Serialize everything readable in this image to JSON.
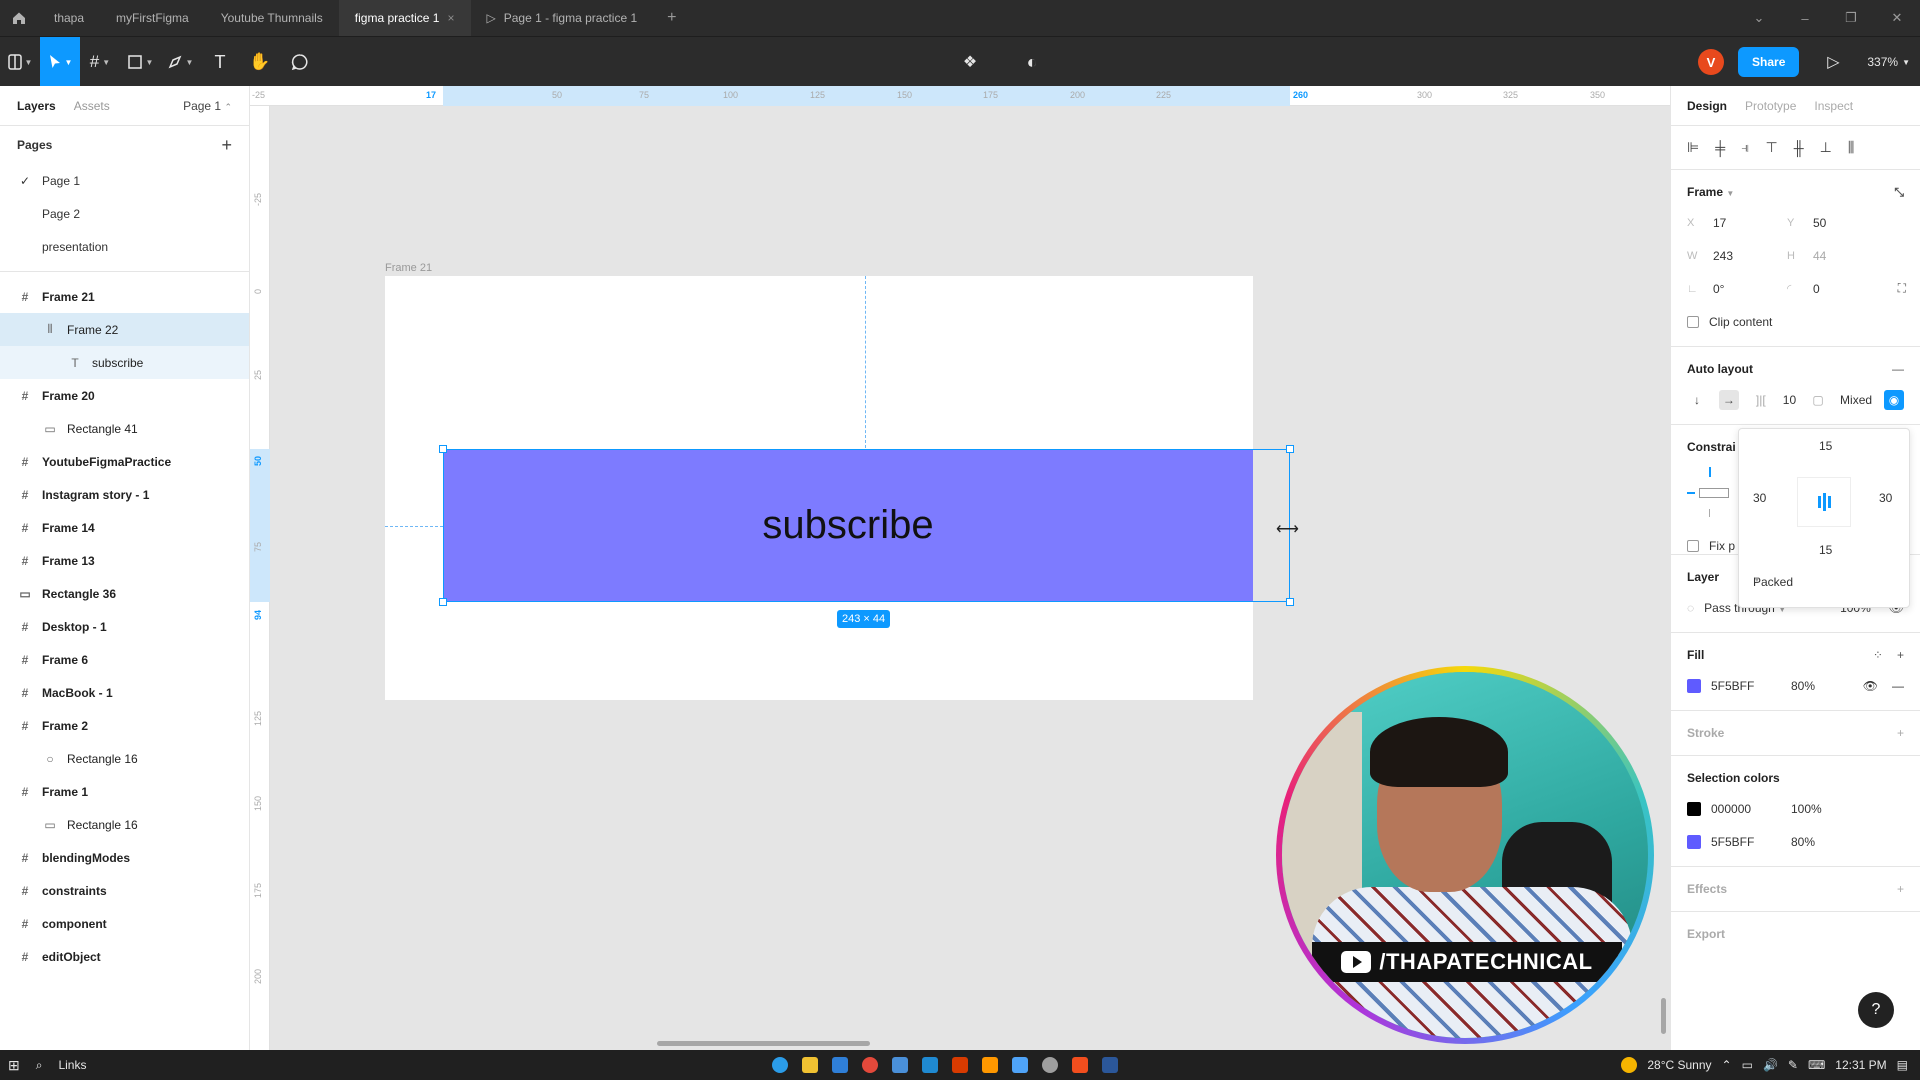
{
  "tabs": [
    {
      "label": "thapa"
    },
    {
      "label": "myFirstFigma"
    },
    {
      "label": "Youtube Thumnails"
    },
    {
      "label": "figma practice 1",
      "active": true
    },
    {
      "label": "Page 1 - figma practice 1"
    }
  ],
  "toolbar": {
    "share_label": "Share",
    "avatar_initial": "V",
    "zoom": "337%"
  },
  "left_panel": {
    "tab_layers": "Layers",
    "tab_assets": "Assets",
    "page_selector": "Page 1",
    "pages_title": "Pages",
    "pages": [
      "Page 1",
      "Page 2",
      "presentation"
    ],
    "layers": [
      {
        "label": "Frame 21",
        "level": 0,
        "icon": "frame-icon"
      },
      {
        "label": "Frame 22",
        "level": 1,
        "icon": "auto-layout-icon"
      },
      {
        "label": "subscribe",
        "level": 2,
        "icon": "text-icon"
      },
      {
        "label": "Frame 20",
        "level": 0,
        "icon": "frame-icon"
      },
      {
        "label": "Rectangle 41",
        "level": 1,
        "icon": "rectangle-icon"
      },
      {
        "label": "YoutubeFigmaPractice",
        "level": 0,
        "icon": "frame-icon"
      },
      {
        "label": "Instagram story - 1",
        "level": 0,
        "icon": "frame-icon"
      },
      {
        "label": "Frame 14",
        "level": 0,
        "icon": "frame-icon"
      },
      {
        "label": "Frame 13",
        "level": 0,
        "icon": "frame-icon"
      },
      {
        "label": "Rectangle 36",
        "level": 0,
        "icon": "rectangle-icon"
      },
      {
        "label": "Desktop - 1",
        "level": 0,
        "icon": "frame-icon"
      },
      {
        "label": "Frame 6",
        "level": 0,
        "icon": "frame-icon"
      },
      {
        "label": "MacBook - 1",
        "level": 0,
        "icon": "frame-icon"
      },
      {
        "label": "Frame 2",
        "level": 0,
        "icon": "frame-icon"
      },
      {
        "label": "Rectangle 16",
        "level": 1,
        "icon": "ellipse-icon"
      },
      {
        "label": "Frame 1",
        "level": 0,
        "icon": "frame-icon"
      },
      {
        "label": "Rectangle 16",
        "level": 1,
        "icon": "rectangle-icon"
      },
      {
        "label": "blendingModes",
        "level": 0,
        "icon": "frame-icon"
      },
      {
        "label": "constraints",
        "level": 0,
        "icon": "frame-icon"
      },
      {
        "label": "component",
        "level": 0,
        "icon": "frame-icon"
      },
      {
        "label": "editObject",
        "level": 0,
        "icon": "frame-icon"
      }
    ]
  },
  "canvas": {
    "ruler_top": [
      "-25",
      "17",
      "50",
      "75",
      "100",
      "125",
      "150",
      "175",
      "200",
      "225",
      "260",
      "300",
      "325",
      "350"
    ],
    "ruler_left": [
      "-25",
      "0",
      "25",
      "50",
      "75",
      "94",
      "125",
      "150",
      "175",
      "200"
    ],
    "frame_label": "Frame 21",
    "button_text": "subscribe",
    "size_badge": "243 × 44",
    "button_color": "#7D7BFF"
  },
  "webcam": {
    "banner_text": "/THAPATECHNICAL"
  },
  "right_panel": {
    "tab_design": "Design",
    "tab_prototype": "Prototype",
    "tab_inspect": "Inspect",
    "frame_title": "Frame",
    "x_label": "X",
    "x": "17",
    "y_label": "Y",
    "y": "50",
    "w_label": "W",
    "w": "243",
    "h_label": "H",
    "h": "44",
    "rotation": "0°",
    "radius": "0",
    "clip_content": "Clip content",
    "auto_layout_title": "Auto layout",
    "spacing": "10",
    "padding_mode": "Mixed",
    "constraints_title": "Constrai",
    "fix_label": "Fix p",
    "padding": {
      "top": "15",
      "left": "30",
      "right": "30",
      "bottom": "15",
      "mode": "Packed"
    },
    "layer_title": "Layer",
    "blend_mode": "Pass through",
    "layer_opacity": "100%",
    "fill_title": "Fill",
    "fill_hex": "5F5BFF",
    "fill_opacity": "80%",
    "fill_color": "#5F5BFF",
    "stroke_title": "Stroke",
    "selection_colors_title": "Selection colors",
    "selection_colors": [
      {
        "hex": "000000",
        "opacity": "100%",
        "color": "#000000"
      },
      {
        "hex": "5F5BFF",
        "opacity": "80%",
        "color": "#5F5BFF"
      }
    ],
    "effects_title": "Effects",
    "export_title": "Export"
  },
  "taskbar": {
    "search_label": "Links",
    "weather": "28°C  Sunny",
    "time": "12:31 PM"
  }
}
